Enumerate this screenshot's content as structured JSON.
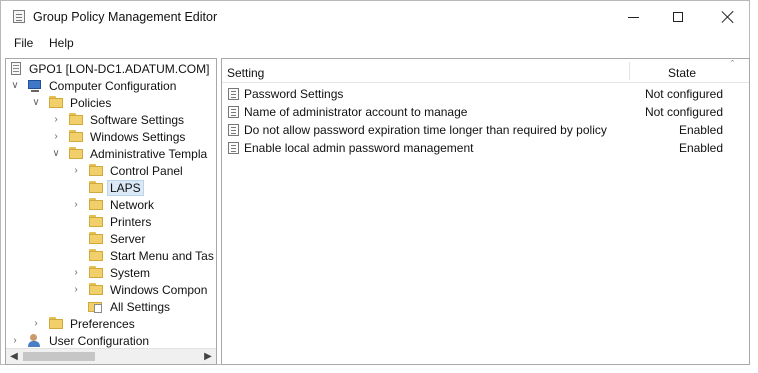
{
  "window": {
    "title": "Group Policy Management Editor",
    "icon": "policy-document-icon",
    "controls": [
      "minimize-icon",
      "maximize-icon",
      "close-icon"
    ]
  },
  "menu": {
    "file": "File",
    "help": "Help"
  },
  "tree": {
    "items": [
      {
        "label": "GPO1 [LON-DC1.ADATUM.COM]",
        "icon": "gpo-icon",
        "expander": ""
      },
      {
        "label": "Computer Configuration",
        "icon": "computer-icon",
        "expander": "expanded"
      },
      {
        "label": "Policies",
        "icon": "folder-icon",
        "expander": "expanded"
      },
      {
        "label": "Software Settings",
        "icon": "folder-icon",
        "expander": "collapsed"
      },
      {
        "label": "Windows Settings",
        "icon": "folder-icon",
        "expander": "collapsed"
      },
      {
        "label": "Administrative Templa",
        "icon": "folder-icon",
        "expander": "expanded"
      },
      {
        "label": "Control Panel",
        "icon": "folder-icon",
        "expander": "collapsed"
      },
      {
        "label": "LAPS",
        "icon": "folder-icon",
        "expander": "",
        "selected": true
      },
      {
        "label": "Network",
        "icon": "folder-icon",
        "expander": "collapsed"
      },
      {
        "label": "Printers",
        "icon": "folder-icon",
        "expander": ""
      },
      {
        "label": "Server",
        "icon": "folder-icon",
        "expander": ""
      },
      {
        "label": "Start Menu and Tas",
        "icon": "folder-icon",
        "expander": ""
      },
      {
        "label": "System",
        "icon": "folder-icon",
        "expander": "collapsed"
      },
      {
        "label": "Windows Compon",
        "icon": "folder-icon",
        "expander": "collapsed"
      },
      {
        "label": "All Settings",
        "icon": "all-settings-icon",
        "expander": ""
      },
      {
        "label": "Preferences",
        "icon": "folder-icon",
        "expander": "collapsed"
      },
      {
        "label": "User Configuration",
        "icon": "user-icon",
        "expander": "collapsed"
      }
    ]
  },
  "details": {
    "column_setting": "Setting",
    "column_state": "State",
    "rows": [
      {
        "name": "Password Settings",
        "state": "Not configured"
      },
      {
        "name": "Name of administrator account to manage",
        "state": "Not configured"
      },
      {
        "name": "Do not allow password expiration time longer than required by policy",
        "state": "Enabled"
      },
      {
        "name": "Enable local admin password management",
        "state": "Enabled"
      }
    ]
  }
}
